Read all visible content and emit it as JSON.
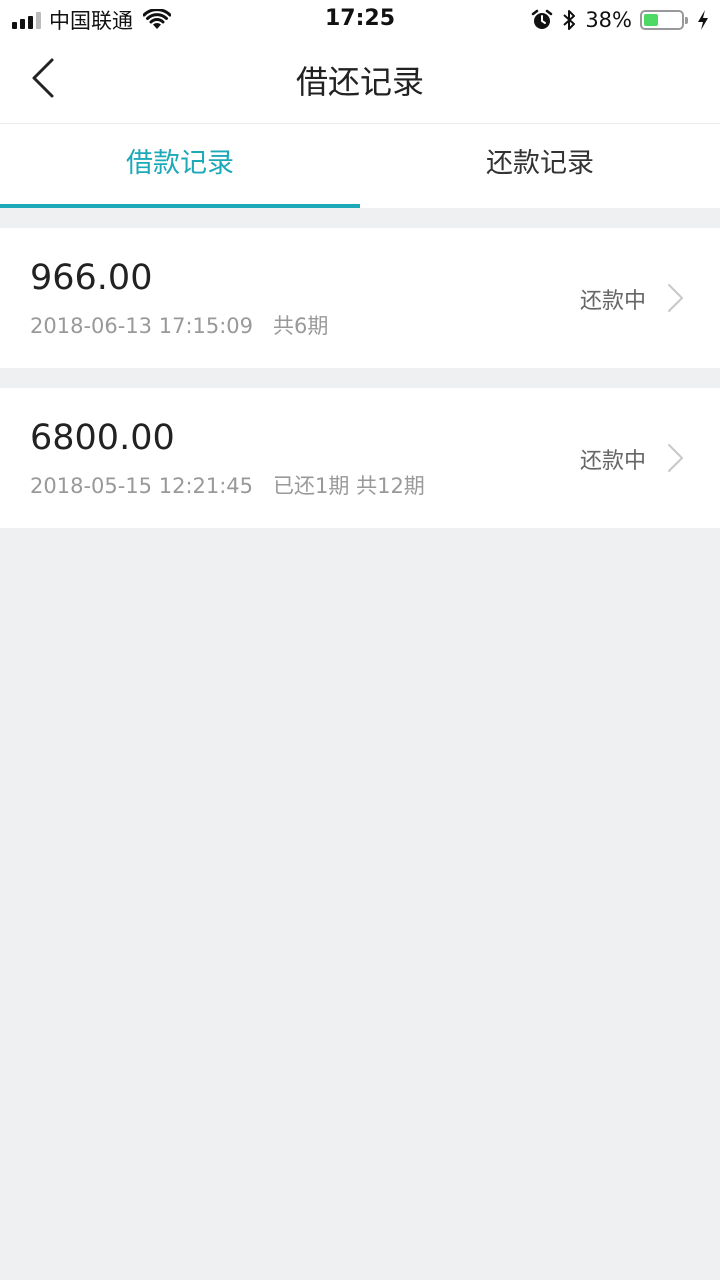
{
  "status_bar": {
    "carrier": "中国联通",
    "time": "17:25",
    "battery_percent": "38%",
    "battery_level": 0.38,
    "icons": [
      "signal-icon",
      "wifi-icon",
      "alarm-icon",
      "bluetooth-icon",
      "battery-icon",
      "charging-icon"
    ]
  },
  "nav": {
    "title": "借还记录",
    "back_icon": "chevron-left-icon"
  },
  "tabs": [
    {
      "label": "借款记录",
      "active": true
    },
    {
      "label": "还款记录",
      "active": false
    }
  ],
  "colors": {
    "accent": "#1da9b8",
    "background": "#eff0f2"
  },
  "records": [
    {
      "amount": "966.00",
      "datetime": "2018-06-13 17:15:09",
      "progress": "共6期",
      "status": "还款中"
    },
    {
      "amount": "6800.00",
      "datetime": "2018-05-15 12:21:45",
      "progress": "已还1期 共12期",
      "status": "还款中"
    }
  ]
}
